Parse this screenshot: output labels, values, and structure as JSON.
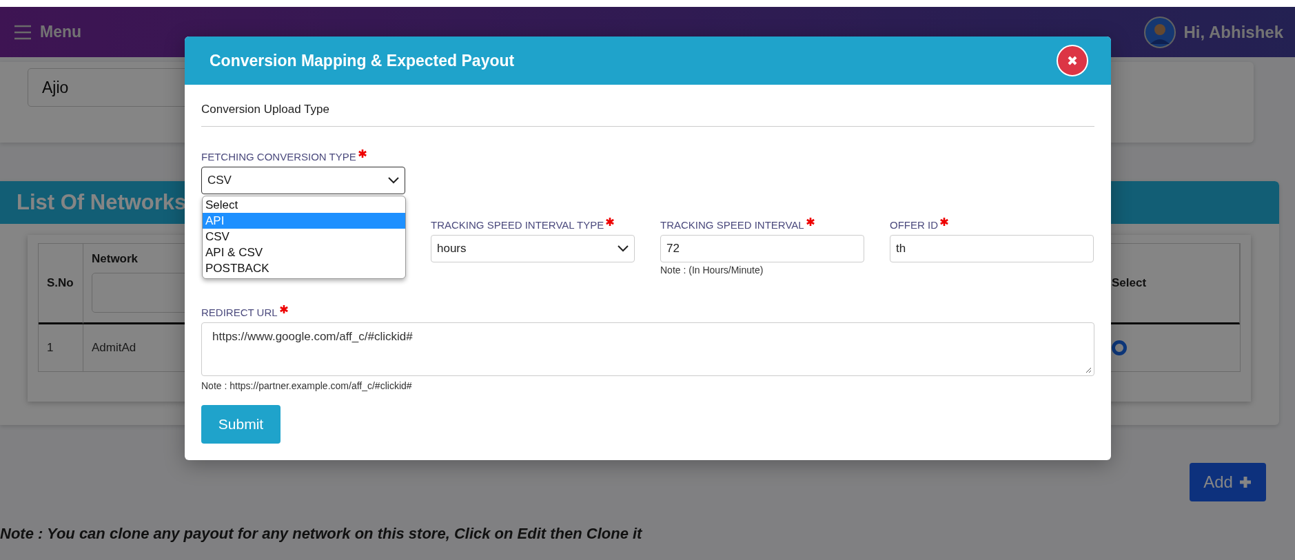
{
  "header": {
    "menu_label": "Menu",
    "greeting": "Hi, Abhishek"
  },
  "store_field": {
    "value": "Ajio"
  },
  "networks_panel": {
    "title": "List Of Networks",
    "columns": [
      {
        "label": "S.No",
        "kind": "plain"
      },
      {
        "label": "Network",
        "kind": "filter"
      },
      {
        "label": "Select",
        "kind": "plain"
      }
    ],
    "rows": [
      {
        "s_no": "1",
        "network": "AdmitAd",
        "selected": true
      }
    ]
  },
  "add_button": {
    "label": "Add"
  },
  "footer_note": "Note : You can clone any payout for any network on this store, Click on Edit then Clone it",
  "modal": {
    "title": "Conversion Mapping & Expected Payout",
    "section_title": "Conversion Upload Type",
    "fetching_type": {
      "label": "FETCHING CONVERSION TYPE",
      "required": true,
      "value": "CSV",
      "expanded": true,
      "options": [
        {
          "label": "Select",
          "highlighted": false
        },
        {
          "label": "API",
          "highlighted": true
        },
        {
          "label": "CSV",
          "highlighted": false
        },
        {
          "label": "API & CSV",
          "highlighted": false
        },
        {
          "label": "POSTBACK",
          "highlighted": false
        }
      ]
    },
    "fields": [
      {
        "label": "TRACKING SPEED INTERVAL TYPE",
        "required": true,
        "kind": "select",
        "value": "hours"
      },
      {
        "label": "TRACKING SPEED INTERVAL",
        "required": true,
        "kind": "input",
        "value": "72",
        "note": "Note : (In Hours/Minute)"
      },
      {
        "label": "OFFER ID",
        "required": true,
        "kind": "input",
        "value": "th"
      }
    ],
    "redirect_url": {
      "label": "REDIRECT URL",
      "required": true,
      "value": "https://www.google.com/aff_c/#clickid#",
      "note": "Note : https://partner.example.com/aff_c/#clickid#"
    },
    "submit_button": "Submit"
  }
}
